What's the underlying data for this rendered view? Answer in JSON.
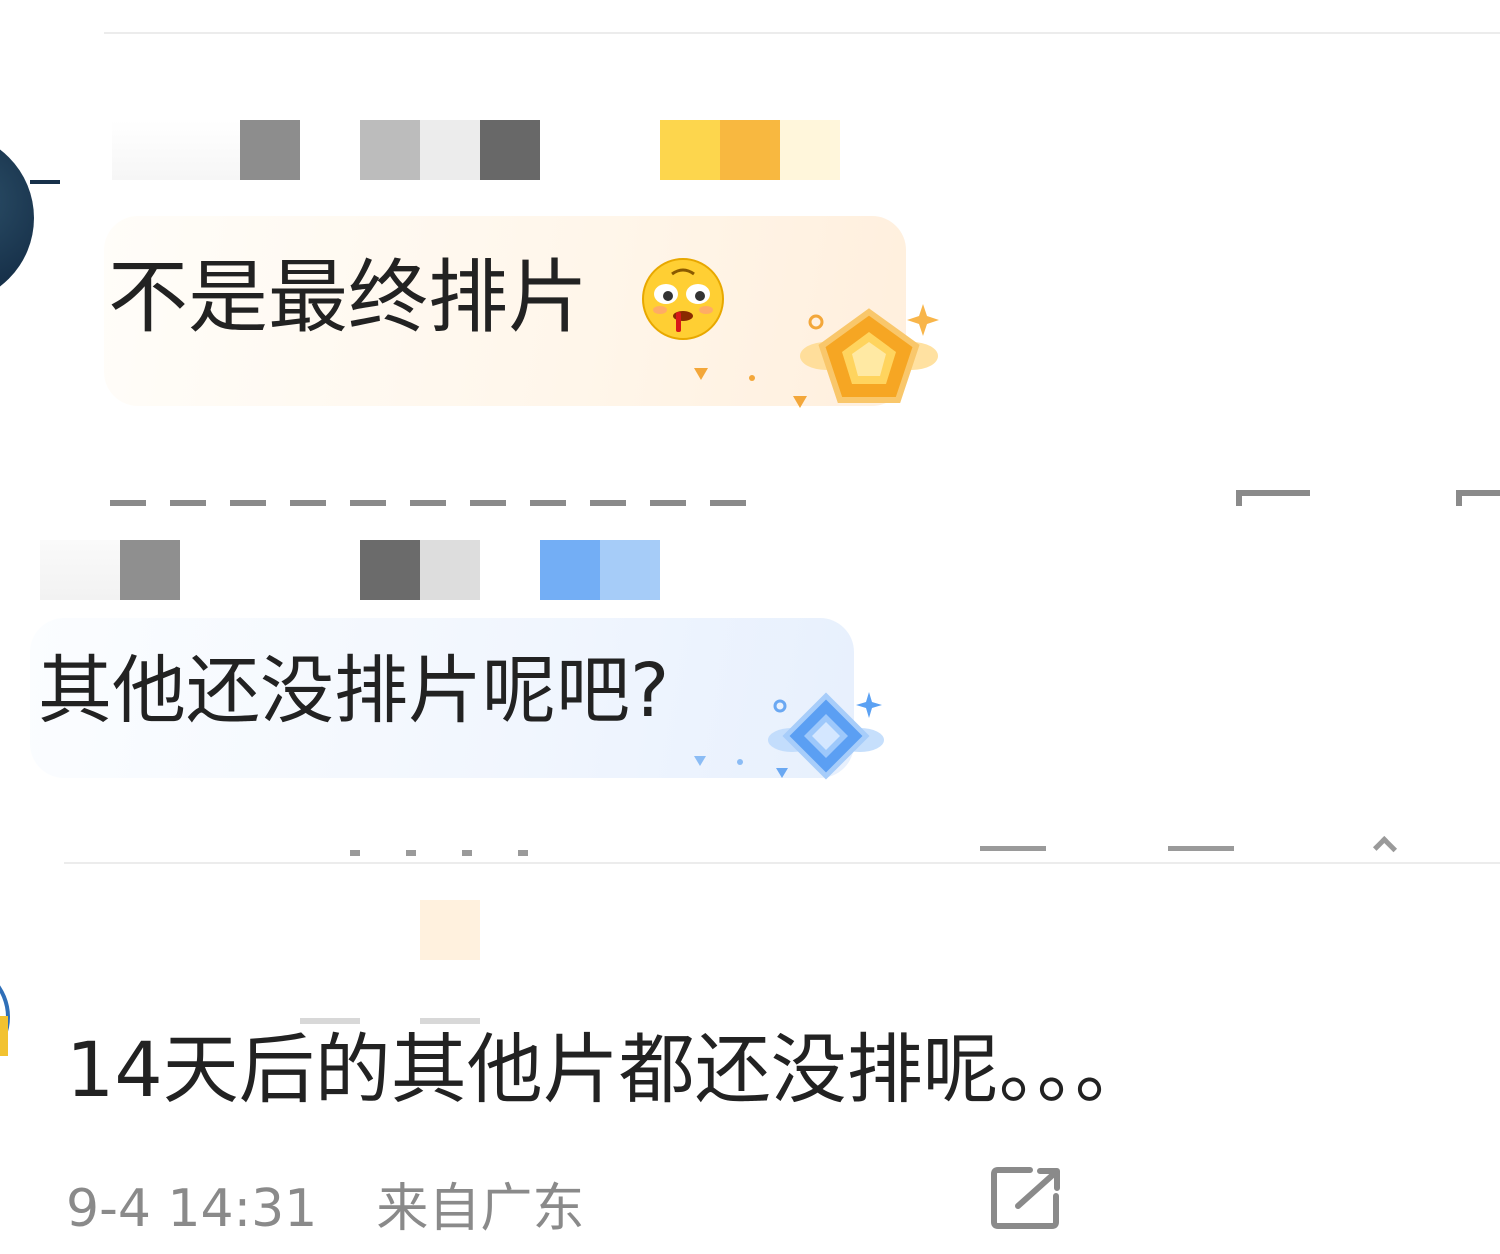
{
  "comments": [
    {
      "text": "不是最终排片",
      "emoji": "bleeding-face-emoji",
      "badge": "gold-pentagon-badge",
      "accent": "#f7b43a"
    },
    {
      "text": "其他还没排片呢吧?",
      "badge": "blue-diamond-badge",
      "accent": "#5aa0f5"
    },
    {
      "text": "14天后的其他片都还没排呢。。。",
      "meta": {
        "time": "9-4 14:31",
        "location": "来自广东"
      },
      "share_icon": "share-icon"
    }
  ],
  "icons": {
    "share": "share-icon",
    "more": "more-icon"
  },
  "colors": {
    "divider": "#ececec",
    "meta_text": "#8a8a8a",
    "gold_tag": [
      "#fdd64d",
      "#f8b840",
      "#fff6db"
    ],
    "blue_tag": [
      "#73aef5",
      "#a6ccf8"
    ]
  }
}
